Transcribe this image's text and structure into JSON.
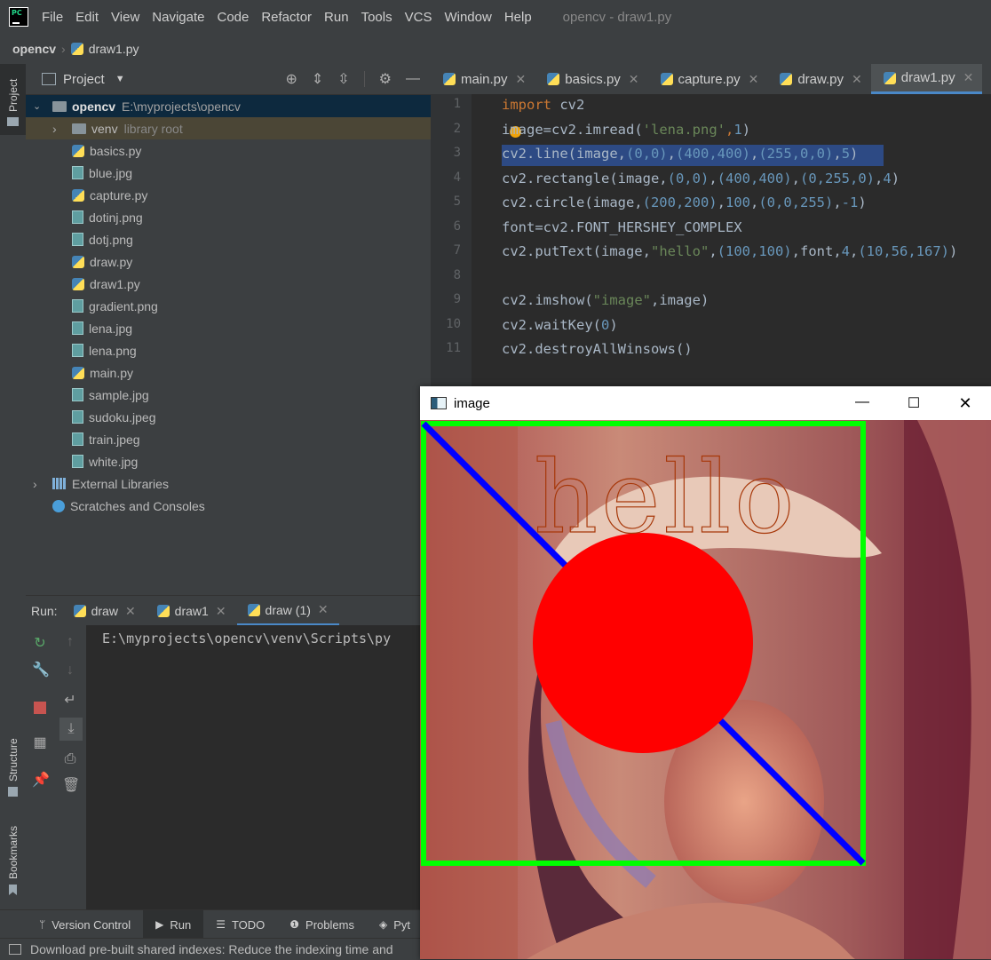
{
  "menu": {
    "items": [
      "File",
      "Edit",
      "View",
      "Navigate",
      "Code",
      "Refactor",
      "Run",
      "Tools",
      "VCS",
      "Window",
      "Help"
    ],
    "window_title": "opencv - draw1.py"
  },
  "breadcrumb": {
    "project": "opencv",
    "file": "draw1.py"
  },
  "left_stripe": {
    "project_label": "Project",
    "structure_label": "Structure",
    "bookmarks_label": "Bookmarks"
  },
  "project_panel": {
    "title": "Project",
    "root_name": "opencv",
    "root_path": "E:\\myprojects\\opencv",
    "venv_name": "venv",
    "venv_note": "library root",
    "files": [
      {
        "name": "basics.py",
        "type": "py"
      },
      {
        "name": "blue.jpg",
        "type": "img"
      },
      {
        "name": "capture.py",
        "type": "py"
      },
      {
        "name": "dotinj.png",
        "type": "img"
      },
      {
        "name": "dotj.png",
        "type": "img"
      },
      {
        "name": "draw.py",
        "type": "py"
      },
      {
        "name": "draw1.py",
        "type": "py"
      },
      {
        "name": "gradient.png",
        "type": "img"
      },
      {
        "name": "lena.jpg",
        "type": "img"
      },
      {
        "name": "lena.png",
        "type": "img"
      },
      {
        "name": "main.py",
        "type": "py"
      },
      {
        "name": "sample.jpg",
        "type": "img"
      },
      {
        "name": "sudoku.jpeg",
        "type": "img"
      },
      {
        "name": "train.jpeg",
        "type": "img"
      },
      {
        "name": "white.jpg",
        "type": "img"
      }
    ],
    "external_libraries": "External Libraries",
    "scratches": "Scratches and Consoles"
  },
  "editor_tabs": [
    {
      "label": "main.py",
      "active": false
    },
    {
      "label": "basics.py",
      "active": false
    },
    {
      "label": "capture.py",
      "active": false
    },
    {
      "label": "draw.py",
      "active": false
    },
    {
      "label": "draw1.py",
      "active": true
    }
  ],
  "code": {
    "line_numbers": [
      "1",
      "2",
      "3",
      "4",
      "5",
      "6",
      "7",
      "8",
      "9",
      "10",
      "11"
    ],
    "lines": [
      [
        {
          "t": "import ",
          "c": "kw"
        },
        {
          "t": "cv2",
          "c": "mod"
        }
      ],
      [
        {
          "t": "image=cv2.",
          "c": "fn"
        },
        {
          "t": "imread",
          "c": "fn"
        },
        {
          "t": "(",
          "c": "fn"
        },
        {
          "t": "'lena.png'",
          "c": "str"
        },
        {
          "t": ",",
          "c": "kw"
        },
        {
          "t": "1",
          "c": "num"
        },
        {
          "t": ")",
          "c": "fn"
        }
      ],
      [
        {
          "t": "cv2.line(image,",
          "c": "fn"
        },
        {
          "t": "(0,0)",
          "c": "num"
        },
        {
          "t": ",",
          "c": "fn"
        },
        {
          "t": "(400,400)",
          "c": "num"
        },
        {
          "t": ",",
          "c": "fn"
        },
        {
          "t": "(255,0,0)",
          "c": "num"
        },
        {
          "t": ",",
          "c": "fn"
        },
        {
          "t": "5",
          "c": "num"
        },
        {
          "t": ")",
          "c": "fn"
        }
      ],
      [
        {
          "t": "cv2.rectangle(image,",
          "c": "fn"
        },
        {
          "t": "(0,0)",
          "c": "num"
        },
        {
          "t": ",",
          "c": "fn"
        },
        {
          "t": "(400,400)",
          "c": "num"
        },
        {
          "t": ",",
          "c": "fn"
        },
        {
          "t": "(0,255,0)",
          "c": "num"
        },
        {
          "t": ",",
          "c": "fn"
        },
        {
          "t": "4",
          "c": "num"
        },
        {
          "t": ")",
          "c": "fn"
        }
      ],
      [
        {
          "t": "cv2.circle(image,",
          "c": "fn"
        },
        {
          "t": "(200,200)",
          "c": "num"
        },
        {
          "t": ",",
          "c": "fn"
        },
        {
          "t": "100",
          "c": "num"
        },
        {
          "t": ",",
          "c": "fn"
        },
        {
          "t": "(0,0,255)",
          "c": "num"
        },
        {
          "t": ",",
          "c": "fn"
        },
        {
          "t": "-1",
          "c": "num"
        },
        {
          "t": ")",
          "c": "fn"
        }
      ],
      [
        {
          "t": "font=cv2.FONT_HERSHEY_COMPLEX",
          "c": "fn"
        }
      ],
      [
        {
          "t": "cv2.putText(image,",
          "c": "fn"
        },
        {
          "t": "\"hello\"",
          "c": "str"
        },
        {
          "t": ",",
          "c": "fn"
        },
        {
          "t": "(100,100)",
          "c": "num"
        },
        {
          "t": ",font,",
          "c": "fn"
        },
        {
          "t": "4",
          "c": "num"
        },
        {
          "t": ",",
          "c": "fn"
        },
        {
          "t": "(10,56,167)",
          "c": "num"
        },
        {
          "t": ")",
          "c": "fn"
        }
      ],
      [],
      [
        {
          "t": "cv2.imshow(",
          "c": "fn"
        },
        {
          "t": "\"image\"",
          "c": "str"
        },
        {
          "t": ",image)",
          "c": "fn"
        }
      ],
      [
        {
          "t": "cv2.waitKey(",
          "c": "fn"
        },
        {
          "t": "0",
          "c": "num"
        },
        {
          "t": ")",
          "c": "fn"
        }
      ],
      [
        {
          "t": "cv2.destroyAllWinsows()",
          "c": "fn"
        }
      ]
    ],
    "highlighted_line": 3
  },
  "run_panel": {
    "label": "Run:",
    "tabs": [
      {
        "label": "draw",
        "active": false
      },
      {
        "label": "draw1",
        "active": false
      },
      {
        "label": "draw (1)",
        "active": true
      }
    ],
    "console_text": "E:\\myprojects\\opencv\\venv\\Scripts\\py"
  },
  "tool_windows": [
    {
      "label": "Version Control",
      "icon": "branch-icon",
      "active": false
    },
    {
      "label": "Run",
      "icon": "play-icon",
      "active": true
    },
    {
      "label": "TODO",
      "icon": "list-icon",
      "active": false
    },
    {
      "label": "Problems",
      "icon": "info-icon",
      "active": false
    },
    {
      "label": "Pyt",
      "icon": "python-packages-icon",
      "active": false
    }
  ],
  "status_bar": {
    "message": "Download pre-built shared indexes: Reduce the indexing time and"
  },
  "image_window": {
    "title": "image",
    "overlay_text": "hello",
    "colors": {
      "line": "#0000ff",
      "rectangle": "#00ff00",
      "circle": "#ff0000",
      "text": "#a7380a"
    }
  }
}
